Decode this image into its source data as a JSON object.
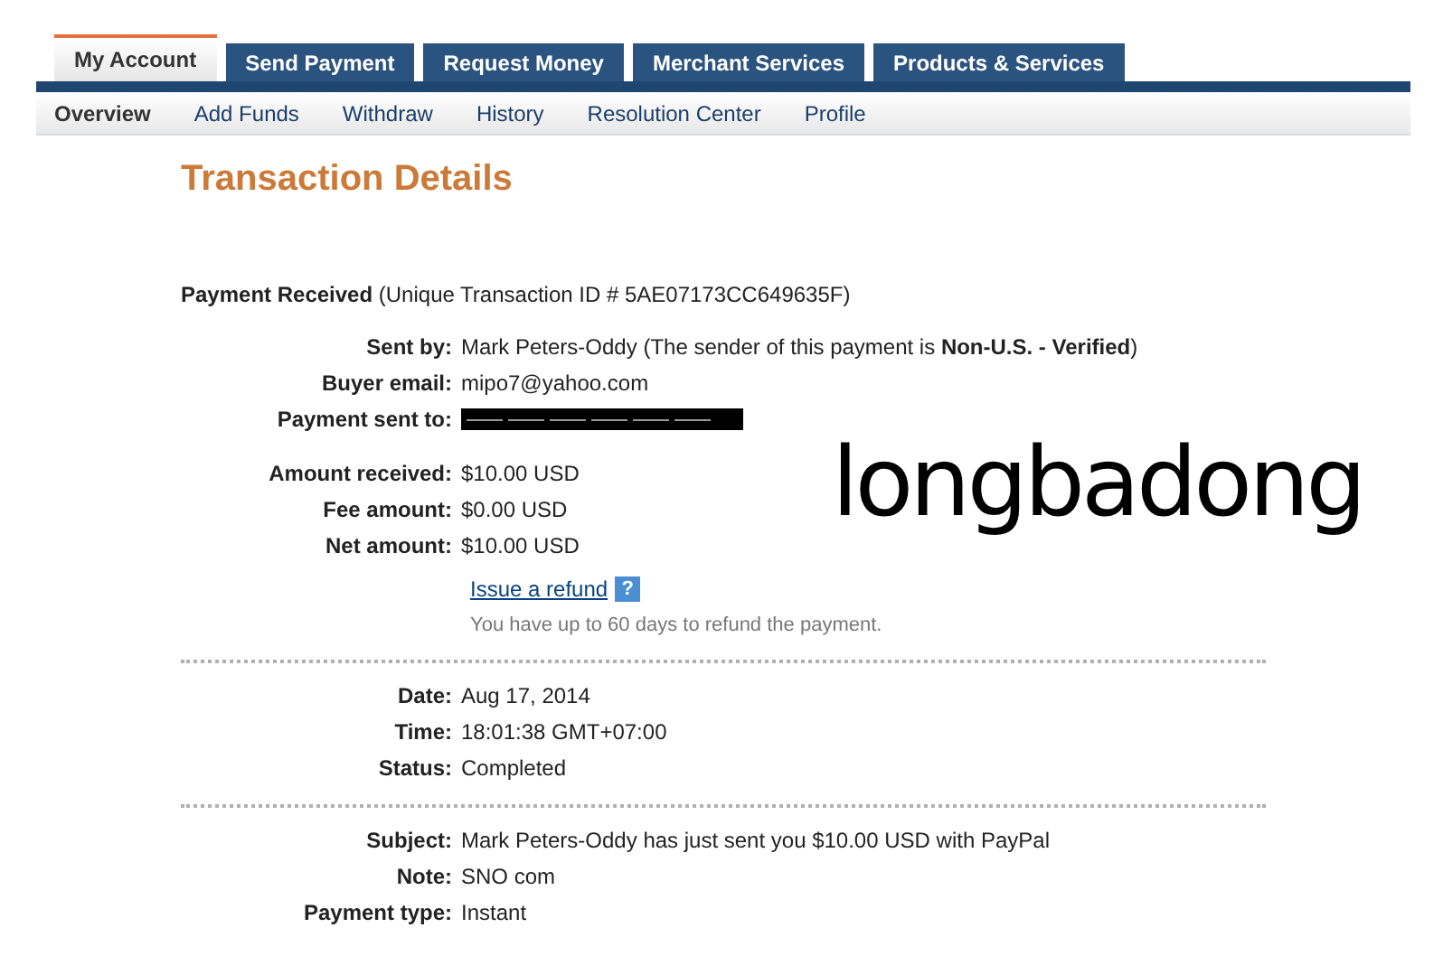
{
  "tabs": [
    {
      "label": "My Account",
      "selected": true
    },
    {
      "label": "Send Payment",
      "selected": false
    },
    {
      "label": "Request Money",
      "selected": false
    },
    {
      "label": "Merchant Services",
      "selected": false
    },
    {
      "label": "Products & Services",
      "selected": false
    }
  ],
  "subnav": [
    {
      "label": "Overview",
      "selected": true
    },
    {
      "label": "Add Funds",
      "selected": false
    },
    {
      "label": "Withdraw",
      "selected": false
    },
    {
      "label": "History",
      "selected": false
    },
    {
      "label": "Resolution Center",
      "selected": false
    },
    {
      "label": "Profile",
      "selected": false
    }
  ],
  "title": "Transaction Details",
  "summary": {
    "heading": "Payment Received",
    "text": "(Unique Transaction ID # 5AE07173CC649635F)"
  },
  "sections": [
    {
      "divider_before": false,
      "rows": [
        {
          "kind": "text",
          "label": "Sent by:",
          "value": "Mark Peters-Oddy (The sender of this payment is **Non-U.S. - Verified**)"
        },
        {
          "kind": "text",
          "label": "Buyer email:",
          "value": "mipo7@yahoo.com"
        },
        {
          "kind": "redacted",
          "label": "Payment sent to:"
        }
      ]
    },
    {
      "divider_before": false,
      "rows": [
        {
          "kind": "text",
          "label": "Amount received:",
          "value": "$10.00 USD"
        },
        {
          "kind": "text",
          "label": "Fee amount:",
          "value": "$0.00 USD"
        },
        {
          "kind": "text",
          "label": "Net amount:",
          "value": "$10.00 USD"
        }
      ],
      "link": {
        "text": "Issue a refund",
        "help": "?"
      },
      "hint": "You have up to 60 days to refund the payment."
    },
    {
      "divider_before": true,
      "rows": [
        {
          "kind": "text",
          "label": "Date:",
          "value": "Aug 17, 2014"
        },
        {
          "kind": "text",
          "label": "Time:",
          "value": "18:01:38 GMT+07:00"
        },
        {
          "kind": "text",
          "label": "Status:",
          "value": "Completed"
        }
      ]
    },
    {
      "divider_before": true,
      "rows": [
        {
          "kind": "text",
          "label": "Subject:",
          "value": "Mark Peters-Oddy has just sent you $10.00 USD with PayPal"
        },
        {
          "kind": "text",
          "label": "Note:",
          "value": "SNO com"
        },
        {
          "kind": "text",
          "label": "Payment type:",
          "value": "Instant"
        }
      ]
    }
  ],
  "overlay_text": "longbadong"
}
